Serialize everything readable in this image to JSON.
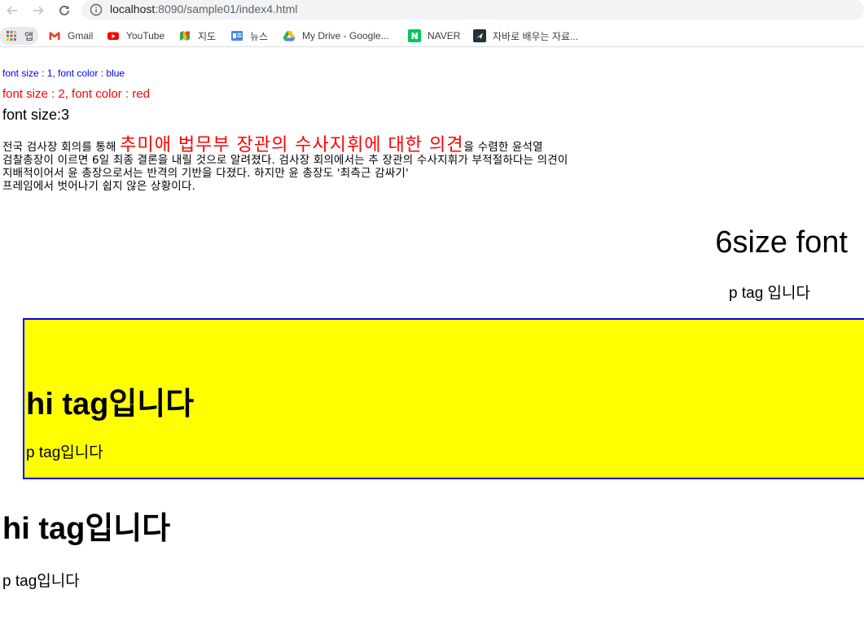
{
  "browser": {
    "url_host": "localhost",
    "url_path": ":8090/sample01/index4.html"
  },
  "bookmarks": [
    {
      "label": "앱",
      "icon": "apps-grid-icon"
    },
    {
      "label": "Gmail",
      "icon": "gmail-icon"
    },
    {
      "label": "YouTube",
      "icon": "youtube-icon"
    },
    {
      "label": "지도",
      "icon": "maps-icon"
    },
    {
      "label": "뉴스",
      "icon": "news-icon"
    },
    {
      "label": "My Drive - Google...",
      "icon": "google-drive-icon"
    },
    {
      "label": "NAVER",
      "icon": "naver-icon"
    },
    {
      "label": "자바로 배우는 자료...",
      "icon": "bookmark-page-icon"
    }
  ],
  "page": {
    "font1": "font size : 1, font color : blue",
    "font2": "font size : 2, font color : red",
    "font3": "font size:3",
    "article": {
      "line1_before": "전국 검사장 회의를 통해 ",
      "line1_highlight": "추미애 법무부 장관의 수사지휘에 대한 의견",
      "line1_after": "을 수렴한 윤석열",
      "line2": "검찰총장이 이르면 6일 최종 결론을 내릴 것으로 알려졌다. 검사장 회의에서는 추 장관의 수사지휘가 부적절하다는 의견이",
      "line3": "지배적이어서 윤 총장으로서는 반격의 기반을 다졌다. 하지만 윤 총장도 '최측근 감싸기'",
      "line4": "프레임에서 벗어나기 쉽지 않은 상황이다."
    },
    "size6": "6size font",
    "p_right": "p tag 입니다",
    "box_h1": "hi tag입니다",
    "box_p": "p tag입니다",
    "h1": "hi tag입니다",
    "p": "p tag입니다"
  },
  "colors": {
    "blue": "#0000ff",
    "red": "#ff0000",
    "box_bg": "#ffff00",
    "box_border": "#0000ff"
  }
}
